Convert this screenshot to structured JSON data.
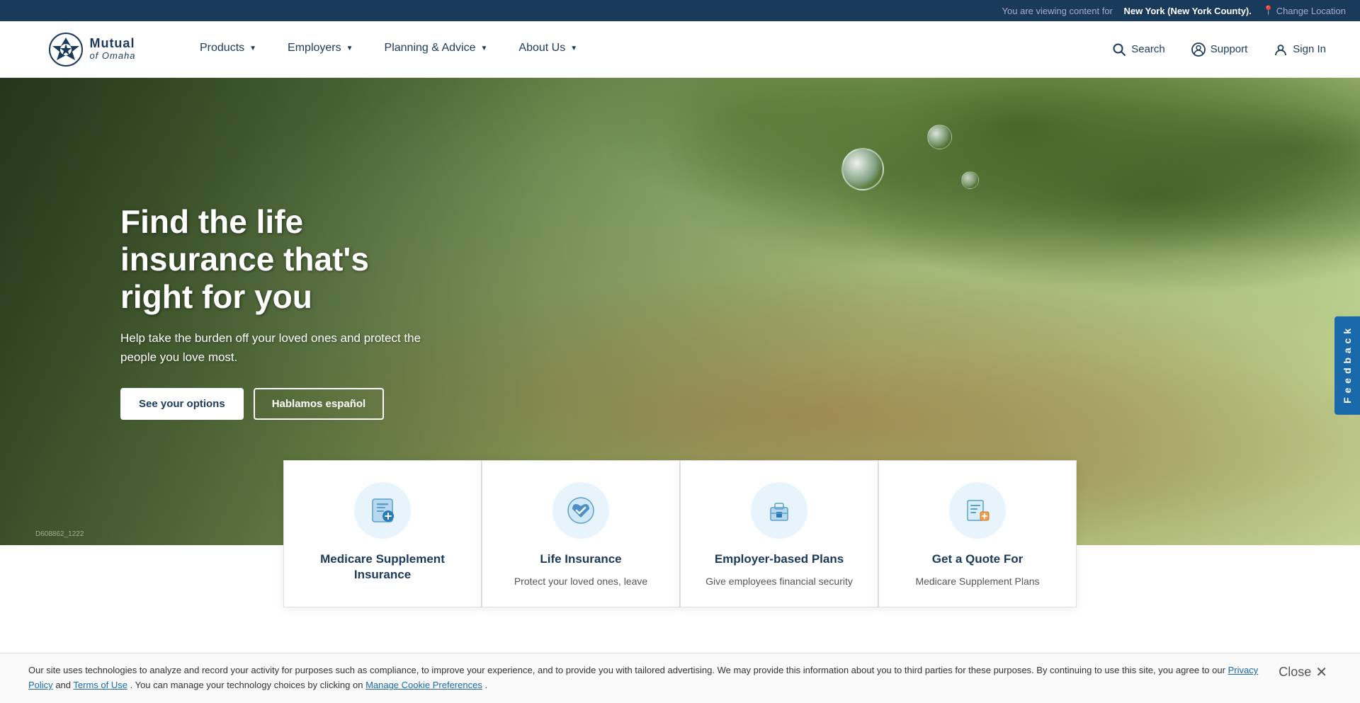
{
  "topbar": {
    "viewing_text": "You are viewing content for",
    "location": "New York (New York County).",
    "change_location": "Change Location",
    "location_icon": "📍"
  },
  "nav": {
    "logo": {
      "icon_letter": "M",
      "text_mutual": "Mutual",
      "text_of_omaha": "of Omaha"
    },
    "links": [
      {
        "label": "Products",
        "has_dropdown": true
      },
      {
        "label": "Employers",
        "has_dropdown": true
      },
      {
        "label": "Planning & Advice",
        "has_dropdown": true
      },
      {
        "label": "About Us",
        "has_dropdown": true
      }
    ],
    "actions": [
      {
        "label": "Search",
        "icon": "search"
      },
      {
        "label": "Support",
        "icon": "person-circle"
      },
      {
        "label": "Sign In",
        "icon": "person"
      }
    ]
  },
  "hero": {
    "title": "Find the life insurance that's right for you",
    "subtitle": "Help take the burden off your loved ones and protect the people you love most.",
    "btn_primary": "See your options",
    "btn_secondary": "Hablamos español",
    "image_id": "D608862_1222"
  },
  "cards": [
    {
      "id": "medicare",
      "icon": "📋",
      "title": "Medicare Supplement Insurance",
      "desc": ""
    },
    {
      "id": "life",
      "icon": "🛡️",
      "title": "Life Insurance",
      "desc": "Protect your loved ones, leave"
    },
    {
      "id": "employer",
      "icon": "💼",
      "title": "Employer-based Plans",
      "desc": "Give employees financial security"
    },
    {
      "id": "quote",
      "icon": "📄",
      "title": "Get a Quote For",
      "desc": "Medicare Supplement Plans"
    }
  ],
  "cookie": {
    "text": "Our site uses technologies to analyze and record your activity for purposes such as compliance, to improve your experience, and to provide you with tailored advertising. We may provide this information about you to third parties for these purposes. By continuing to use this site, you agree to our",
    "privacy_link": "Privacy Policy",
    "and": "and",
    "terms_link": "Terms of Use",
    "manage_text": ". You can manage your technology choices by clicking on",
    "manage_link": "Manage Cookie Preferences",
    "period": ".",
    "close_label": "Close"
  },
  "feedback": {
    "label": "F e e d b a c k"
  }
}
